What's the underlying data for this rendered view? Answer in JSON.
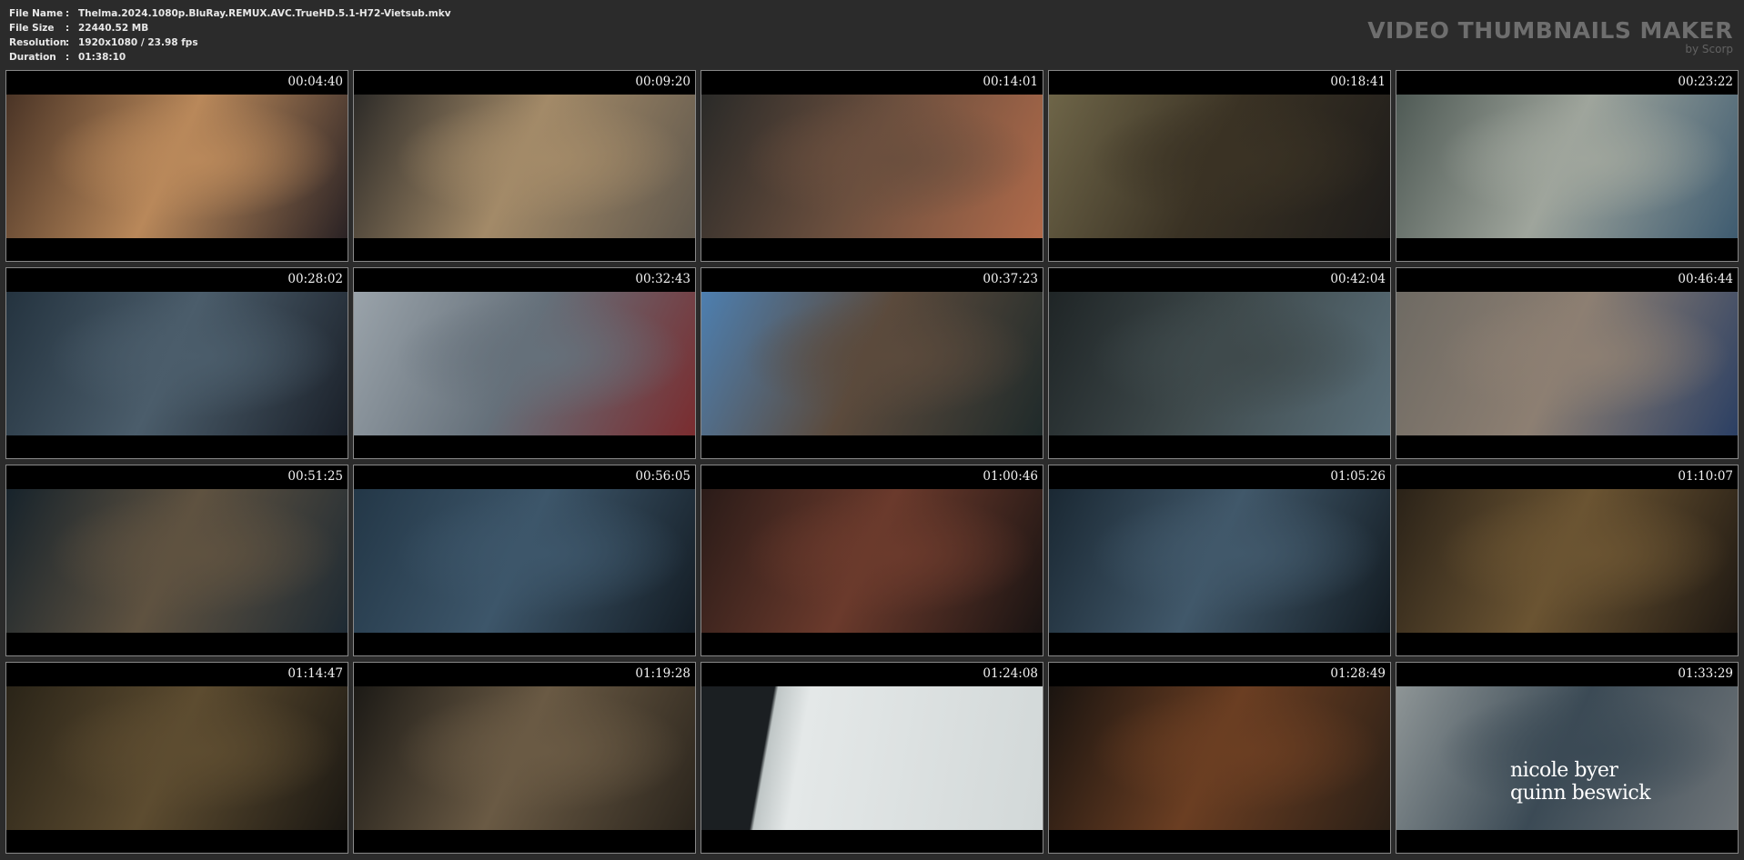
{
  "header": {
    "rows": [
      {
        "key": "File Name",
        "value": "Thelma.2024.1080p.BluRay.REMUX.AVC.TrueHD.5.1-H72-Vietsub.mkv"
      },
      {
        "key": "File Size",
        "value": "22440.52 MB"
      },
      {
        "key": "Resolution",
        "value": "1920x1080 / 23.98 fps"
      },
      {
        "key": "Duration",
        "value": "01:38:10"
      }
    ],
    "separator": ":",
    "brand": {
      "title": "VIDEO THUMBNAILS MAKER",
      "byline": "by Scorp"
    }
  },
  "thumbnails": [
    {
      "time": "00:04:40",
      "colors": [
        "#4a3426",
        "#b9885a",
        "#2a2224"
      ]
    },
    {
      "time": "00:09:20",
      "colors": [
        "#2d2b28",
        "#a38a68",
        "#5f574c"
      ]
    },
    {
      "time": "00:14:01",
      "colors": [
        "#2a2a28",
        "#6b4f3e",
        "#b06a4a"
      ]
    },
    {
      "time": "00:18:41",
      "colors": [
        "#6e6548",
        "#3a3224",
        "#1e1c1a"
      ]
    },
    {
      "time": "00:23:22",
      "colors": [
        "#4f5a55",
        "#9fa59c",
        "#3e5b70"
      ]
    },
    {
      "time": "00:28:02",
      "colors": [
        "#24333f",
        "#4b5d6b",
        "#1a2029"
      ]
    },
    {
      "time": "00:32:43",
      "colors": [
        "#9aa3aa",
        "#65707a",
        "#7a2c2f"
      ]
    },
    {
      "time": "00:37:23",
      "colors": [
        "#4d7fb0",
        "#5b4a3c",
        "#1f2a2a"
      ]
    },
    {
      "time": "00:42:04",
      "colors": [
        "#1f2526",
        "#3f4a4c",
        "#5a6f7a"
      ]
    },
    {
      "time": "00:46:44",
      "colors": [
        "#6e6a63",
        "#8d7f72",
        "#2b3f63"
      ]
    },
    {
      "time": "00:51:25",
      "colors": [
        "#17232b",
        "#5f5240",
        "#1e2a33"
      ]
    },
    {
      "time": "00:56:05",
      "colors": [
        "#233747",
        "#3d566a",
        "#131c24"
      ]
    },
    {
      "time": "01:00:46",
      "colors": [
        "#2a1b18",
        "#6b3a2c",
        "#191312"
      ]
    },
    {
      "time": "01:05:26",
      "colors": [
        "#1a2833",
        "#41586a",
        "#121b22"
      ]
    },
    {
      "time": "01:10:07",
      "colors": [
        "#2a2218",
        "#6b5432",
        "#1e1812"
      ]
    },
    {
      "time": "01:14:47",
      "colors": [
        "#2a2418",
        "#5d4c30",
        "#1a1712"
      ]
    },
    {
      "time": "01:19:28",
      "colors": [
        "#1c1a16",
        "#6a5a44",
        "#2a241c"
      ]
    },
    {
      "time": "01:24:08",
      "colors": [
        "#e4e8e8",
        "#d2d8d8",
        "#1b1f22"
      ],
      "screen": true
    },
    {
      "time": "01:28:49",
      "colors": [
        "#1a1410",
        "#6b3e22",
        "#2a1f16"
      ]
    },
    {
      "time": "01:33:29",
      "colors": [
        "#8e9596",
        "#3b4a55",
        "#6e7478"
      ],
      "caption": [
        "nicole byer",
        "quinn beswick"
      ]
    }
  ]
}
